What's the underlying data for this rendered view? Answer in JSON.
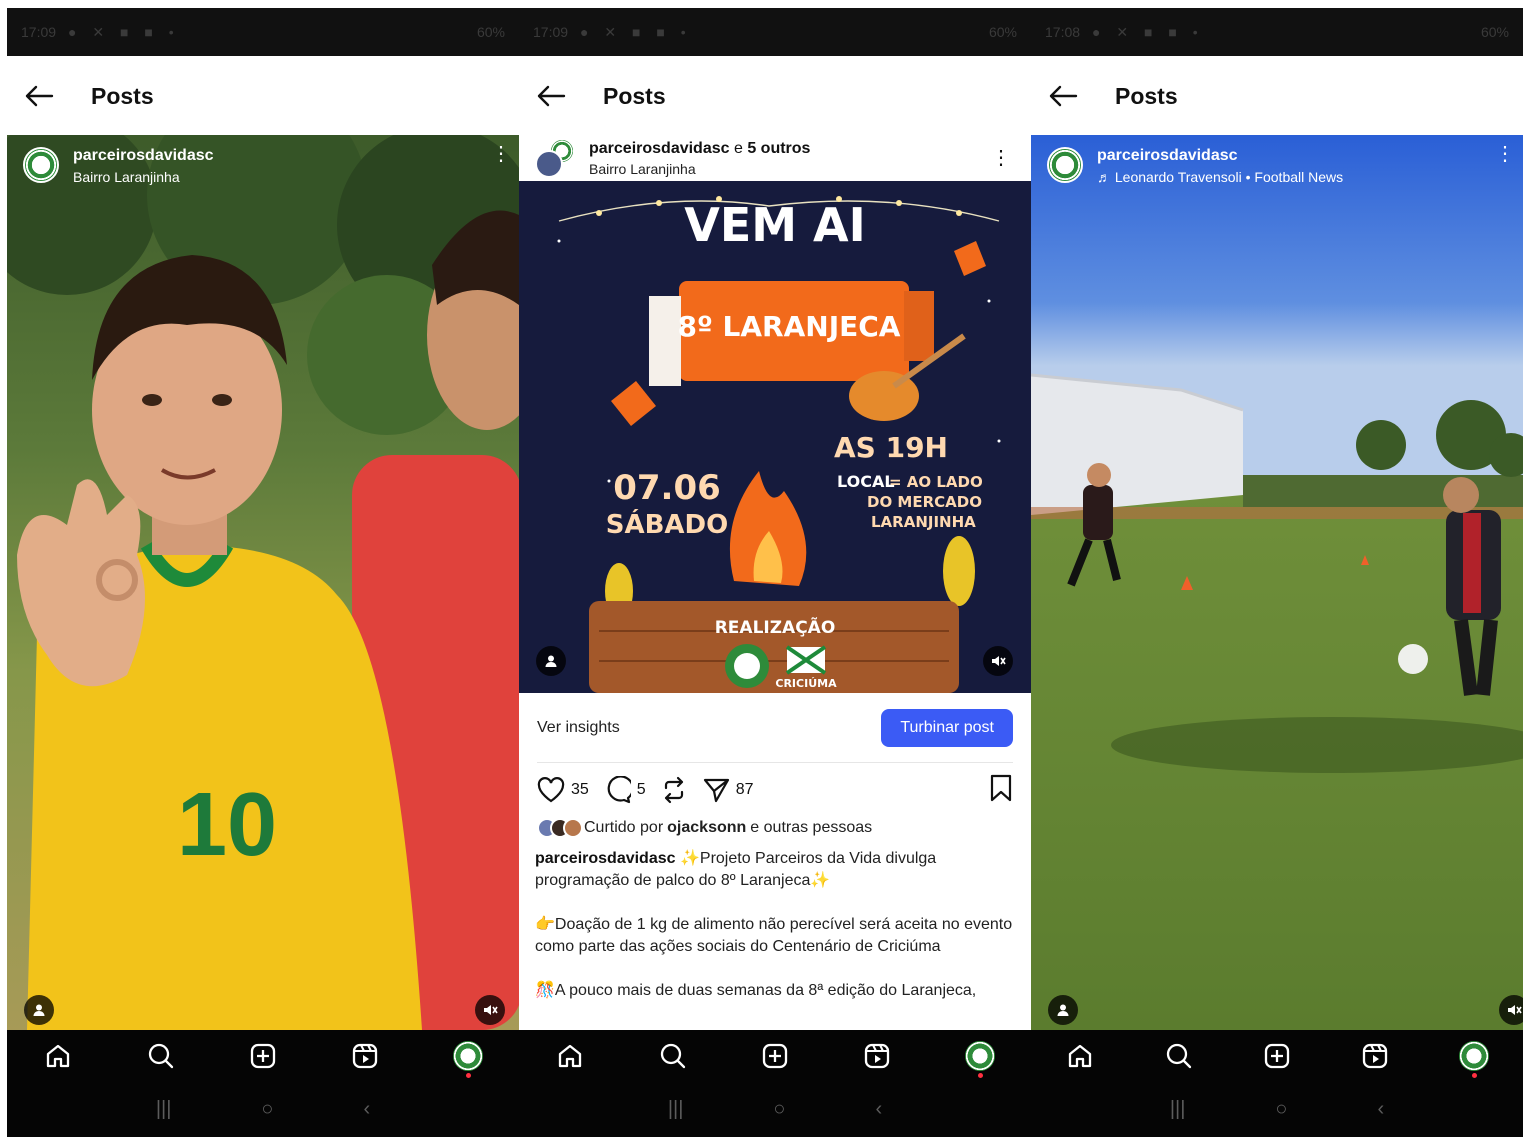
{
  "panels": [
    {
      "status": {
        "time": "17:09",
        "battery": "60%"
      },
      "header_title": "Posts",
      "post": {
        "username": "parceirosdavidasc",
        "subtitle": "Bairro Laranjinha"
      }
    },
    {
      "status": {
        "time": "17:09",
        "battery": "60%"
      },
      "header_title": "Posts",
      "post": {
        "username": "parceirosdavidasc",
        "collab_connector": " e ",
        "collab_others": "5 outros",
        "subtitle": "Bairro Laranjinha",
        "poster": {
          "headline": "VEM AI",
          "event": "8º LARANJECA",
          "date": "07.06",
          "day": "SÁBADO",
          "time": "AS 19H",
          "local_label": "LOCAL",
          "local_line1": "= AO LADO",
          "local_line2": "DO MERCADO",
          "local_line3": "LARANJINHA",
          "realizacao": "REALIZAÇÃO",
          "sponsor_logo_text": "CRICIÚMA"
        },
        "insights_label": "Ver insights",
        "boost_label": "Turbinar post",
        "likes": "35",
        "comments": "5",
        "shares": "87",
        "liked_prefix": "Curtido por ",
        "liked_user": "ojacksonn",
        "liked_suffix": " e outras pessoas",
        "caption_user": "parceirosdavidasc",
        "caption_line1": " ✨Projeto Parceiros da Vida divulga programação de palco do 8º Laranjeca✨",
        "caption_line2": "👉Doação de 1 kg de alimento não perecível será aceita no evento como parte das ações sociais do Centenário de Criciúma",
        "caption_line3": "🎊A pouco mais de duas semanas da 8ª edição do Laranjeca,"
      }
    },
    {
      "status": {
        "time": "17:08",
        "battery": "60%"
      },
      "header_title": "Posts",
      "post": {
        "username": "parceirosdavidasc",
        "subtitle": "Leonardo Travensoli • Football News"
      }
    }
  ],
  "colors": {
    "accent": "#3b5bf5",
    "brand_green": "#2e8b3a",
    "notification": "#ff3040"
  },
  "icons": [
    "back-arrow-icon",
    "kebab-icon",
    "user-tag-icon",
    "mute-icon",
    "home-icon",
    "search-icon",
    "create-icon",
    "reels-icon",
    "heart-icon",
    "comment-icon",
    "repost-icon",
    "share-icon",
    "bookmark-icon",
    "music-note-icon"
  ]
}
